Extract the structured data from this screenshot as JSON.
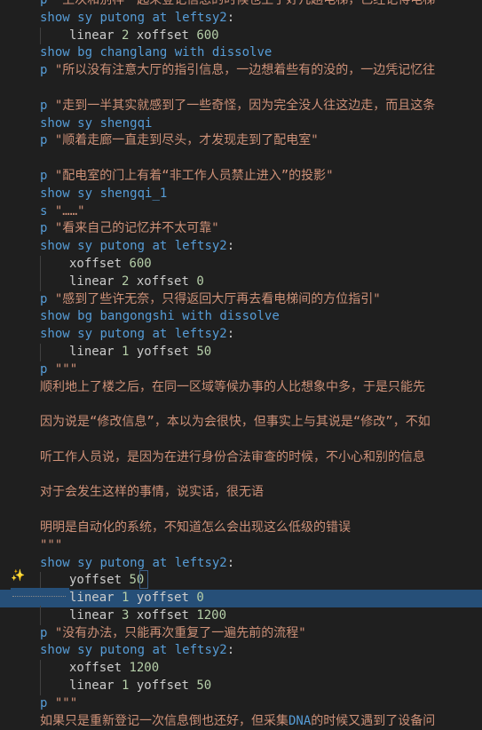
{
  "editor": {
    "lines": [
      {
        "indent": 0,
        "tokens": [
          {
            "t": "p ",
            "c": "kw"
          },
          {
            "t": "\"上次和别样一起来登记信息的时候也上了好几趟电梯，已经记得电梯",
            "c": "str"
          }
        ]
      },
      {
        "indent": 0,
        "tokens": [
          {
            "t": "show",
            "c": "kw"
          },
          {
            "t": " sy ",
            "c": "kw"
          },
          {
            "t": "putong",
            "c": "kw"
          },
          {
            "t": " at ",
            "c": "kw"
          },
          {
            "t": "leftsy2",
            "c": "kw"
          },
          {
            "t": ":",
            "c": "sym"
          }
        ]
      },
      {
        "indent": 1,
        "tokens": [
          {
            "t": "linear",
            "c": "plain"
          },
          {
            "t": " ",
            "c": "plain"
          },
          {
            "t": "2",
            "c": "num"
          },
          {
            "t": " xoffset ",
            "c": "plain"
          },
          {
            "t": "600",
            "c": "num"
          }
        ]
      },
      {
        "indent": 0,
        "tokens": [
          {
            "t": "show",
            "c": "kw"
          },
          {
            "t": " bg ",
            "c": "kw"
          },
          {
            "t": "changlang",
            "c": "kw"
          },
          {
            "t": " with ",
            "c": "kw"
          },
          {
            "t": "dissolve",
            "c": "kw"
          }
        ]
      },
      {
        "indent": 0,
        "tokens": [
          {
            "t": "p ",
            "c": "kw"
          },
          {
            "t": "\"所以没有注意大厅的指引信息，一边想着些有的没的，一边凭记忆往",
            "c": "str"
          }
        ]
      },
      {
        "indent": -1,
        "tokens": []
      },
      {
        "indent": 0,
        "tokens": [
          {
            "t": "p ",
            "c": "kw"
          },
          {
            "t": "\"走到一半其实就感到了一些奇怪，因为完全没人往这边走，而且这条",
            "c": "str"
          }
        ]
      },
      {
        "indent": 0,
        "tokens": [
          {
            "t": "show",
            "c": "kw"
          },
          {
            "t": " sy ",
            "c": "kw"
          },
          {
            "t": "shengqi",
            "c": "kw"
          }
        ]
      },
      {
        "indent": 0,
        "tokens": [
          {
            "t": "p ",
            "c": "kw"
          },
          {
            "t": "\"顺着走廊一直走到尽头，才发现走到了配电室\"",
            "c": "str"
          }
        ]
      },
      {
        "indent": -1,
        "tokens": []
      },
      {
        "indent": 0,
        "tokens": [
          {
            "t": "p ",
            "c": "kw"
          },
          {
            "t": "\"配电室的门上有着“非工作人员禁止进入”的投影\"",
            "c": "str"
          }
        ]
      },
      {
        "indent": 0,
        "tokens": [
          {
            "t": "show",
            "c": "kw"
          },
          {
            "t": " sy ",
            "c": "kw"
          },
          {
            "t": "shengqi_1",
            "c": "kw"
          }
        ]
      },
      {
        "indent": 0,
        "tokens": [
          {
            "t": "s ",
            "c": "kw"
          },
          {
            "t": "\"……\"",
            "c": "str"
          }
        ]
      },
      {
        "indent": 0,
        "tokens": [
          {
            "t": "p ",
            "c": "kw"
          },
          {
            "t": "\"看来自己的记忆并不太可靠\"",
            "c": "str"
          }
        ]
      },
      {
        "indent": 0,
        "tokens": [
          {
            "t": "show",
            "c": "kw"
          },
          {
            "t": " sy ",
            "c": "kw"
          },
          {
            "t": "putong",
            "c": "kw"
          },
          {
            "t": " at ",
            "c": "kw"
          },
          {
            "t": "leftsy2",
            "c": "kw"
          },
          {
            "t": ":",
            "c": "sym"
          }
        ]
      },
      {
        "indent": 1,
        "tokens": [
          {
            "t": "xoffset ",
            "c": "plain"
          },
          {
            "t": "600",
            "c": "num"
          }
        ]
      },
      {
        "indent": 1,
        "tokens": [
          {
            "t": "linear",
            "c": "plain"
          },
          {
            "t": " ",
            "c": "plain"
          },
          {
            "t": "2",
            "c": "num"
          },
          {
            "t": " xoffset ",
            "c": "plain"
          },
          {
            "t": "0",
            "c": "num"
          }
        ]
      },
      {
        "indent": 0,
        "tokens": [
          {
            "t": "p ",
            "c": "kw"
          },
          {
            "t": "\"感到了些许无奈，只得返回大厅再去看电梯间的方位指引\"",
            "c": "str"
          }
        ]
      },
      {
        "indent": 0,
        "tokens": [
          {
            "t": "show",
            "c": "kw"
          },
          {
            "t": " bg ",
            "c": "kw"
          },
          {
            "t": "bangongshi",
            "c": "kw"
          },
          {
            "t": " with ",
            "c": "kw"
          },
          {
            "t": "dissolve",
            "c": "kw"
          }
        ]
      },
      {
        "indent": 0,
        "tokens": [
          {
            "t": "show",
            "c": "kw"
          },
          {
            "t": " sy ",
            "c": "kw"
          },
          {
            "t": "putong",
            "c": "kw"
          },
          {
            "t": " at ",
            "c": "kw"
          },
          {
            "t": "leftsy2",
            "c": "kw"
          },
          {
            "t": ":",
            "c": "sym"
          }
        ]
      },
      {
        "indent": 1,
        "tokens": [
          {
            "t": "linear",
            "c": "plain"
          },
          {
            "t": " ",
            "c": "plain"
          },
          {
            "t": "1",
            "c": "num"
          },
          {
            "t": " yoffset ",
            "c": "plain"
          },
          {
            "t": "50",
            "c": "num"
          }
        ]
      },
      {
        "indent": 0,
        "tokens": [
          {
            "t": "p ",
            "c": "kw"
          },
          {
            "t": "\"\"\"",
            "c": "str"
          }
        ]
      },
      {
        "indent": 0,
        "tokens": [
          {
            "t": "顺利地上了楼之后，在同一区域等候办事的人比想象中多，于是只能先",
            "c": "str"
          }
        ]
      },
      {
        "indent": -1,
        "tokens": []
      },
      {
        "indent": 0,
        "tokens": [
          {
            "t": "因为说是“修改信息”，本以为会很快，但事实上与其说是“修改”，不如",
            "c": "str"
          }
        ]
      },
      {
        "indent": -1,
        "tokens": []
      },
      {
        "indent": 0,
        "tokens": [
          {
            "t": "听工作人员说，是因为在进行身份合法审查的时候，不小心和别的信息",
            "c": "str"
          }
        ]
      },
      {
        "indent": -1,
        "tokens": []
      },
      {
        "indent": 0,
        "tokens": [
          {
            "t": "对于会发生这样的事情，说实话，很无语",
            "c": "str"
          }
        ]
      },
      {
        "indent": -1,
        "tokens": []
      },
      {
        "indent": 0,
        "tokens": [
          {
            "t": "明明是自动化的系统，不知道怎么会出现这么低级的错误",
            "c": "str"
          }
        ]
      },
      {
        "indent": 0,
        "tokens": [
          {
            "t": "\"\"\"",
            "c": "str"
          }
        ]
      },
      {
        "indent": 0,
        "tokens": [
          {
            "t": "show",
            "c": "kw"
          },
          {
            "t": " sy ",
            "c": "kw"
          },
          {
            "t": "putong",
            "c": "kw"
          },
          {
            "t": " at ",
            "c": "kw"
          },
          {
            "t": "leftsy2",
            "c": "kw"
          },
          {
            "t": ":",
            "c": "sym"
          }
        ]
      },
      {
        "indent": 1,
        "tokens": [
          {
            "t": "yoffset ",
            "c": "plain"
          },
          {
            "t": "50",
            "c": "num"
          }
        ]
      },
      {
        "indent": 1,
        "selected": true,
        "tokens": [
          {
            "t": "linear",
            "c": "plain"
          },
          {
            "t": " ",
            "c": "plain"
          },
          {
            "t": "1",
            "c": "num"
          },
          {
            "t": " yoffset ",
            "c": "plain"
          },
          {
            "t": "0",
            "c": "num"
          }
        ]
      },
      {
        "indent": 1,
        "tokens": [
          {
            "t": "linear",
            "c": "plain"
          },
          {
            "t": " ",
            "c": "plain"
          },
          {
            "t": "3",
            "c": "num"
          },
          {
            "t": " xoffset ",
            "c": "plain"
          },
          {
            "t": "1200",
            "c": "num"
          }
        ]
      },
      {
        "indent": 0,
        "tokens": [
          {
            "t": "p ",
            "c": "kw"
          },
          {
            "t": "\"没有办法，只能再次重复了一遍先前的流程\"",
            "c": "str"
          }
        ]
      },
      {
        "indent": 0,
        "tokens": [
          {
            "t": "show",
            "c": "kw"
          },
          {
            "t": " sy ",
            "c": "kw"
          },
          {
            "t": "putong",
            "c": "kw"
          },
          {
            "t": " at ",
            "c": "kw"
          },
          {
            "t": "leftsy2",
            "c": "kw"
          },
          {
            "t": ":",
            "c": "sym"
          }
        ]
      },
      {
        "indent": 1,
        "tokens": [
          {
            "t": "xoffset ",
            "c": "plain"
          },
          {
            "t": "1200",
            "c": "num"
          }
        ]
      },
      {
        "indent": 1,
        "tokens": [
          {
            "t": "linear",
            "c": "plain"
          },
          {
            "t": " ",
            "c": "plain"
          },
          {
            "t": "1",
            "c": "num"
          },
          {
            "t": " yoffset ",
            "c": "plain"
          },
          {
            "t": "50",
            "c": "num"
          }
        ]
      },
      {
        "indent": 0,
        "tokens": [
          {
            "t": "p ",
            "c": "kw"
          },
          {
            "t": "\"\"\"",
            "c": "str"
          }
        ]
      },
      {
        "indent": 0,
        "tokens": [
          {
            "t": "如果只是重新登记一次信息倒也还好，但采集",
            "c": "str"
          },
          {
            "t": "DNA",
            "c": "kw"
          },
          {
            "t": "的时候又遇到了设备问",
            "c": "str"
          }
        ]
      }
    ]
  },
  "gutter": {
    "lightbulb_icon": "lightbulb-sparkle-icon"
  },
  "colors": {
    "background": "#1f1f1f",
    "keyword": "#569cd6",
    "string": "#ce9178",
    "number": "#b5cea8",
    "selection": "#264f78"
  }
}
